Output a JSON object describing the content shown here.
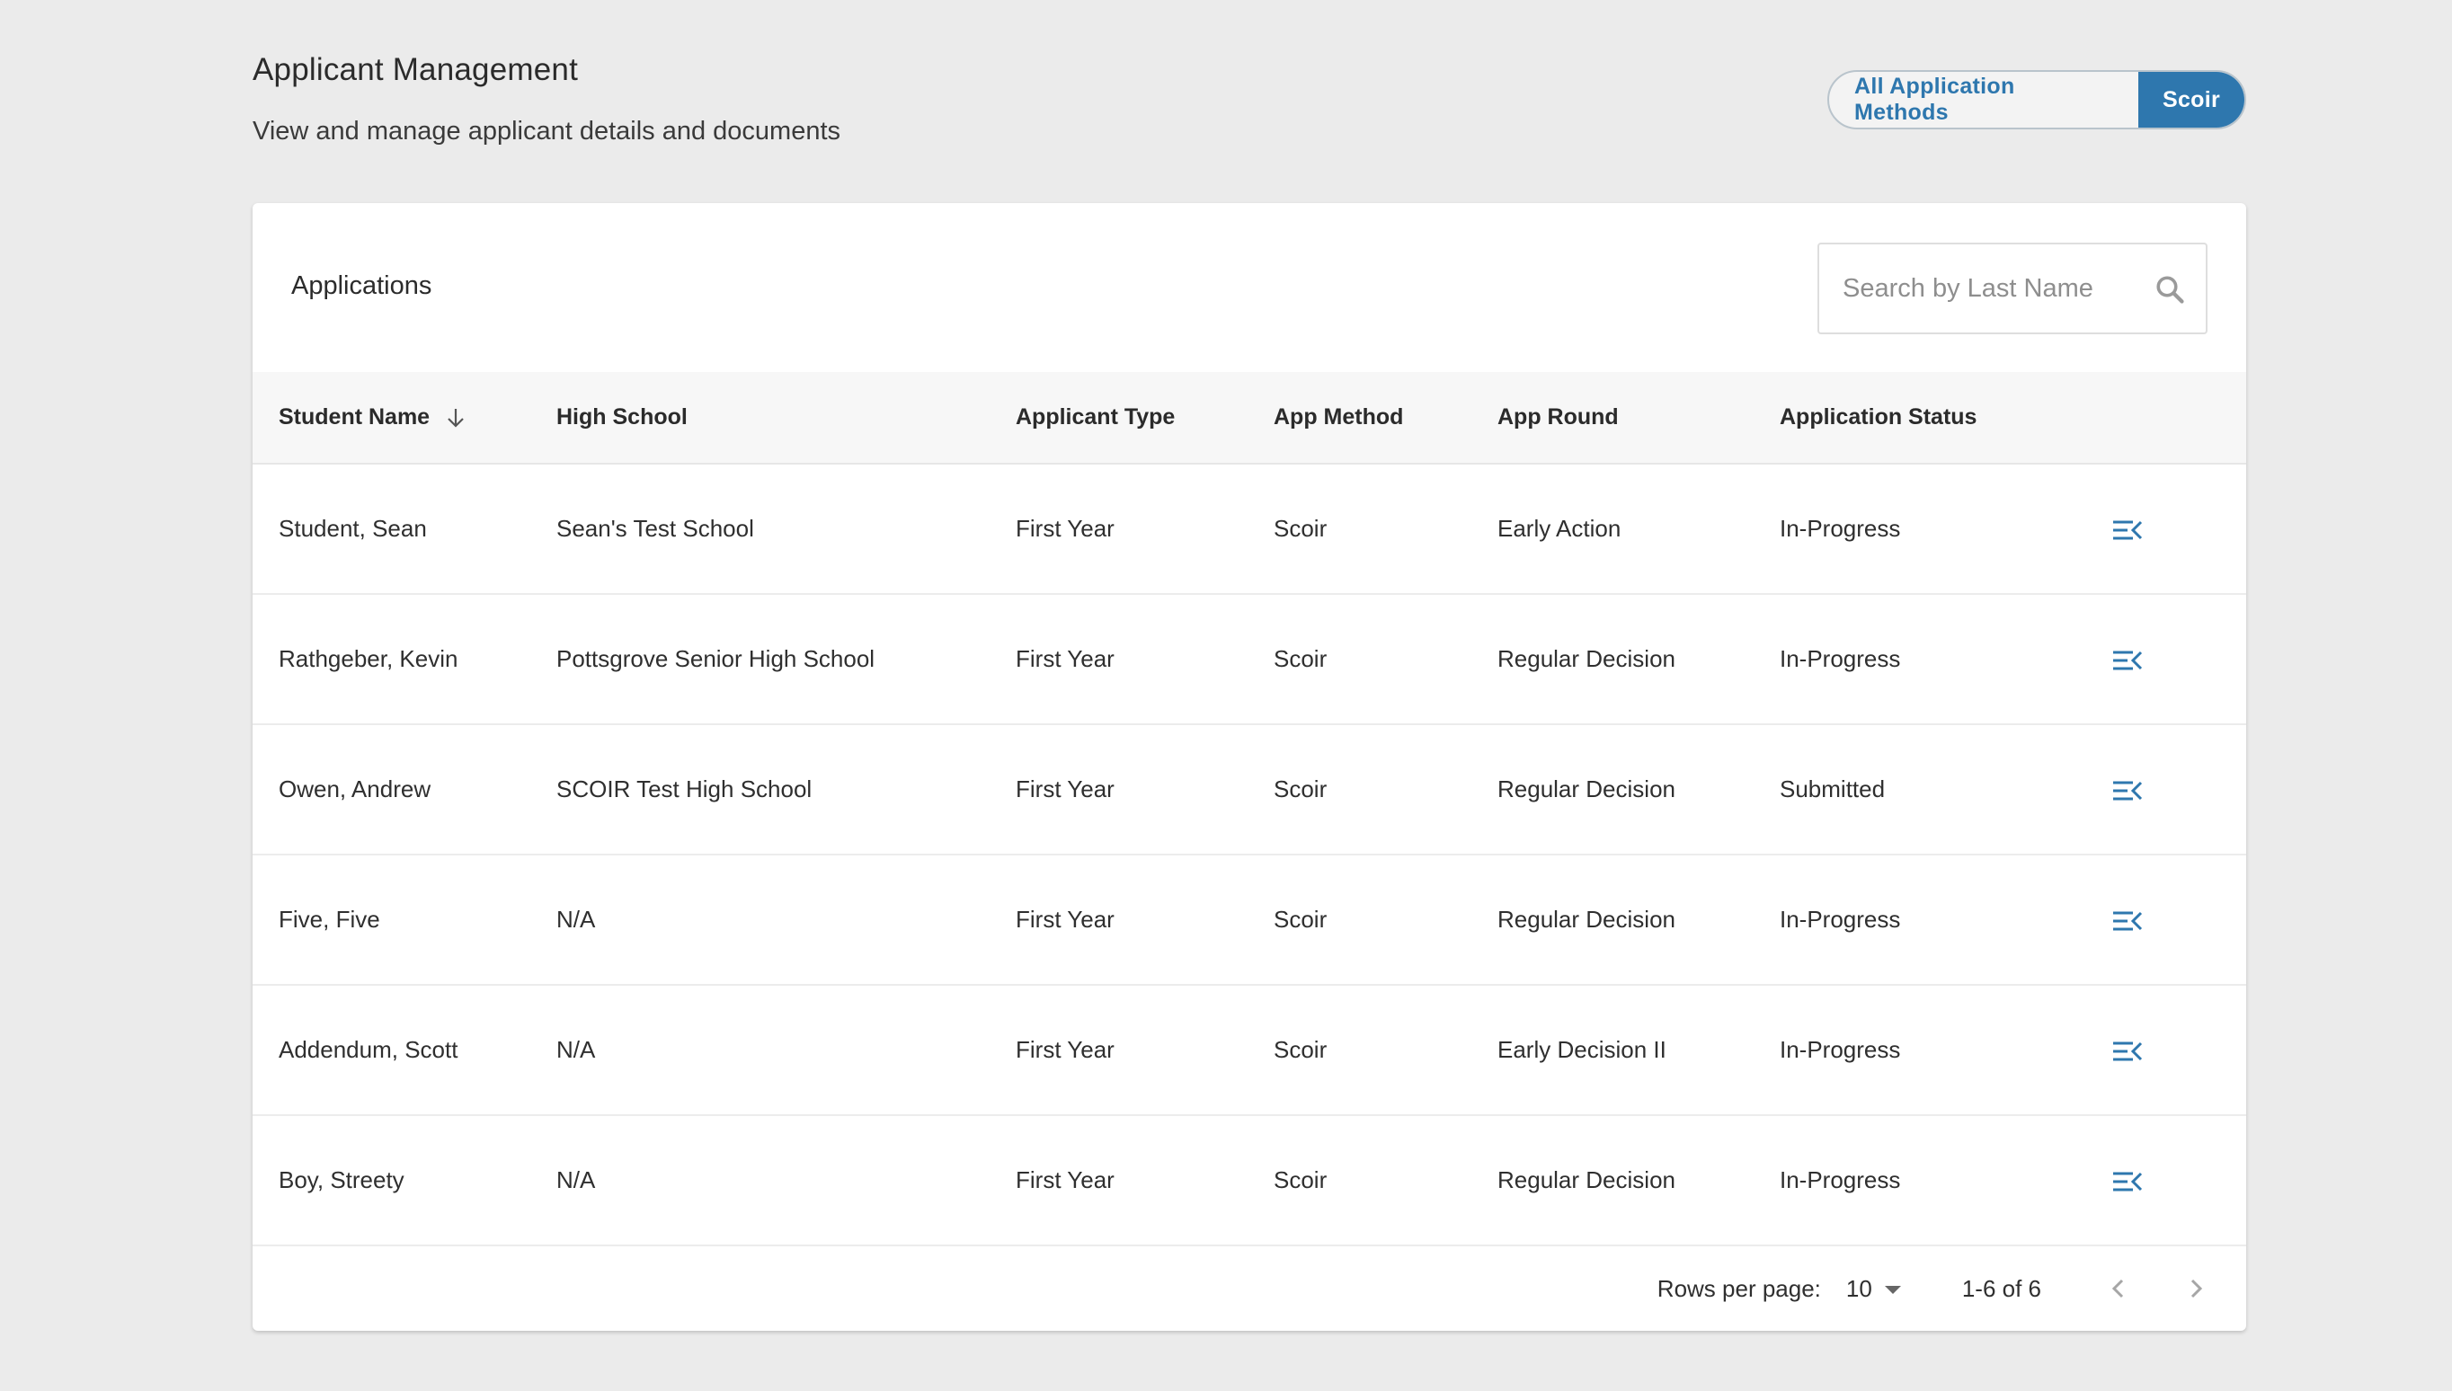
{
  "header": {
    "title": "Applicant Management",
    "subtitle": "View and manage applicant details and documents",
    "method_toggle": {
      "options": [
        "All Application Methods",
        "Scoir"
      ],
      "selected": "Scoir"
    }
  },
  "applications": {
    "title": "Applications",
    "search": {
      "placeholder": "Search by Last Name",
      "value": ""
    },
    "columns": [
      "Student Name",
      "High School",
      "Applicant Type",
      "App Method",
      "App Round",
      "Application Status"
    ],
    "sort": {
      "column": "Student Name",
      "direction": "descending"
    },
    "rows": [
      {
        "student_name": "Student, Sean",
        "high_school": "Sean's Test School",
        "applicant_type": "First Year",
        "app_method": "Scoir",
        "app_round": "Early Action",
        "status": "In-Progress"
      },
      {
        "student_name": "Rathgeber, Kevin",
        "high_school": "Pottsgrove Senior High School",
        "applicant_type": "First Year",
        "app_method": "Scoir",
        "app_round": "Regular Decision",
        "status": "In-Progress"
      },
      {
        "student_name": "Owen, Andrew",
        "high_school": "SCOIR Test High School",
        "applicant_type": "First Year",
        "app_method": "Scoir",
        "app_round": "Regular Decision",
        "status": "Submitted"
      },
      {
        "student_name": "Five, Five",
        "high_school": "N/A",
        "applicant_type": "First Year",
        "app_method": "Scoir",
        "app_round": "Regular Decision",
        "status": "In-Progress"
      },
      {
        "student_name": "Addendum, Scott",
        "high_school": "N/A",
        "applicant_type": "First Year",
        "app_method": "Scoir",
        "app_round": "Early Decision II",
        "status": "In-Progress"
      },
      {
        "student_name": "Boy, Streety",
        "high_school": "N/A",
        "applicant_type": "First Year",
        "app_method": "Scoir",
        "app_round": "Regular Decision",
        "status": "In-Progress"
      }
    ],
    "pagination": {
      "rows_per_page_label": "Rows per page:",
      "rows_per_page": "10",
      "range": "1-6 of 6"
    }
  },
  "icons": {
    "search": "search-icon",
    "sort": "arrow-down-icon",
    "row_action": "open-detail-icon",
    "prev": "chevron-left-icon",
    "next": "chevron-right-icon",
    "dropdown": "caret-down-icon"
  },
  "colors": {
    "accent": "#2e77ae",
    "background": "#ebebeb",
    "card": "#ffffff",
    "header_row": "#f7f7f7"
  }
}
